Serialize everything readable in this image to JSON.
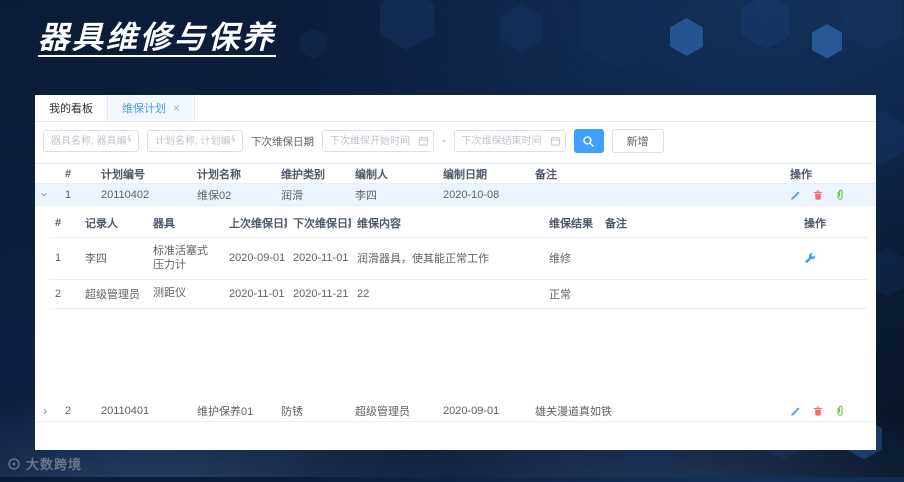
{
  "page": {
    "title": "器具维修与保养"
  },
  "footer": {
    "brand": "大数跨境"
  },
  "tabs": {
    "dashboard": "我的看板",
    "plan": "维保计划",
    "close": "×"
  },
  "filters": {
    "equipment_placeholder": "器具名称, 器具编号",
    "plan_placeholder": "计划名称, 计划编号",
    "date_label": "下次维保日期",
    "date_start_placeholder": "下次维保开始时间",
    "date_separator": "-",
    "date_end_placeholder": "下次维保结束时间",
    "add_button": "新增"
  },
  "plans": {
    "headers": {
      "index": "#",
      "plan_no": "计划编号",
      "plan_name": "计划名称",
      "category": "维护类别",
      "creator": "编制人",
      "date": "编制日期",
      "remark": "备注",
      "actions": "操作"
    },
    "rows": [
      {
        "index": "1",
        "plan_no": "20110402",
        "plan_name": "维保02",
        "category": "润滑",
        "creator": "李四",
        "date": "2020-10-08",
        "remark": ""
      },
      {
        "index": "2",
        "plan_no": "20110401",
        "plan_name": "维护保养01",
        "category": "防锈",
        "creator": "超级管理员",
        "date": "2020-09-01",
        "remark": "雄关漫道真如铁"
      }
    ]
  },
  "records": {
    "headers": {
      "index": "#",
      "recorder": "记录人",
      "equipment": "器具",
      "last_date": "上次维保日期",
      "next_date": "下次维保日期",
      "content": "维保内容",
      "result": "维保结果",
      "remark": "备注",
      "actions": "操作"
    },
    "rows": [
      {
        "index": "1",
        "recorder": "李四",
        "equipment": "标准活塞式压力计",
        "last_date": "2020-09-01",
        "next_date": "2020-11-01",
        "content": "润滑器具，使其能正常工作",
        "result": "维修",
        "remark": ""
      },
      {
        "index": "2",
        "recorder": "超级管理员",
        "equipment": "测距仪",
        "last_date": "2020-11-01",
        "next_date": "2020-11-21",
        "content": "22",
        "result": "正常",
        "remark": ""
      }
    ]
  },
  "colors": {
    "accent": "#409eff",
    "danger": "#f56c6c",
    "success": "#67c23a",
    "expanded_row_bg": "#ecf5ff"
  }
}
